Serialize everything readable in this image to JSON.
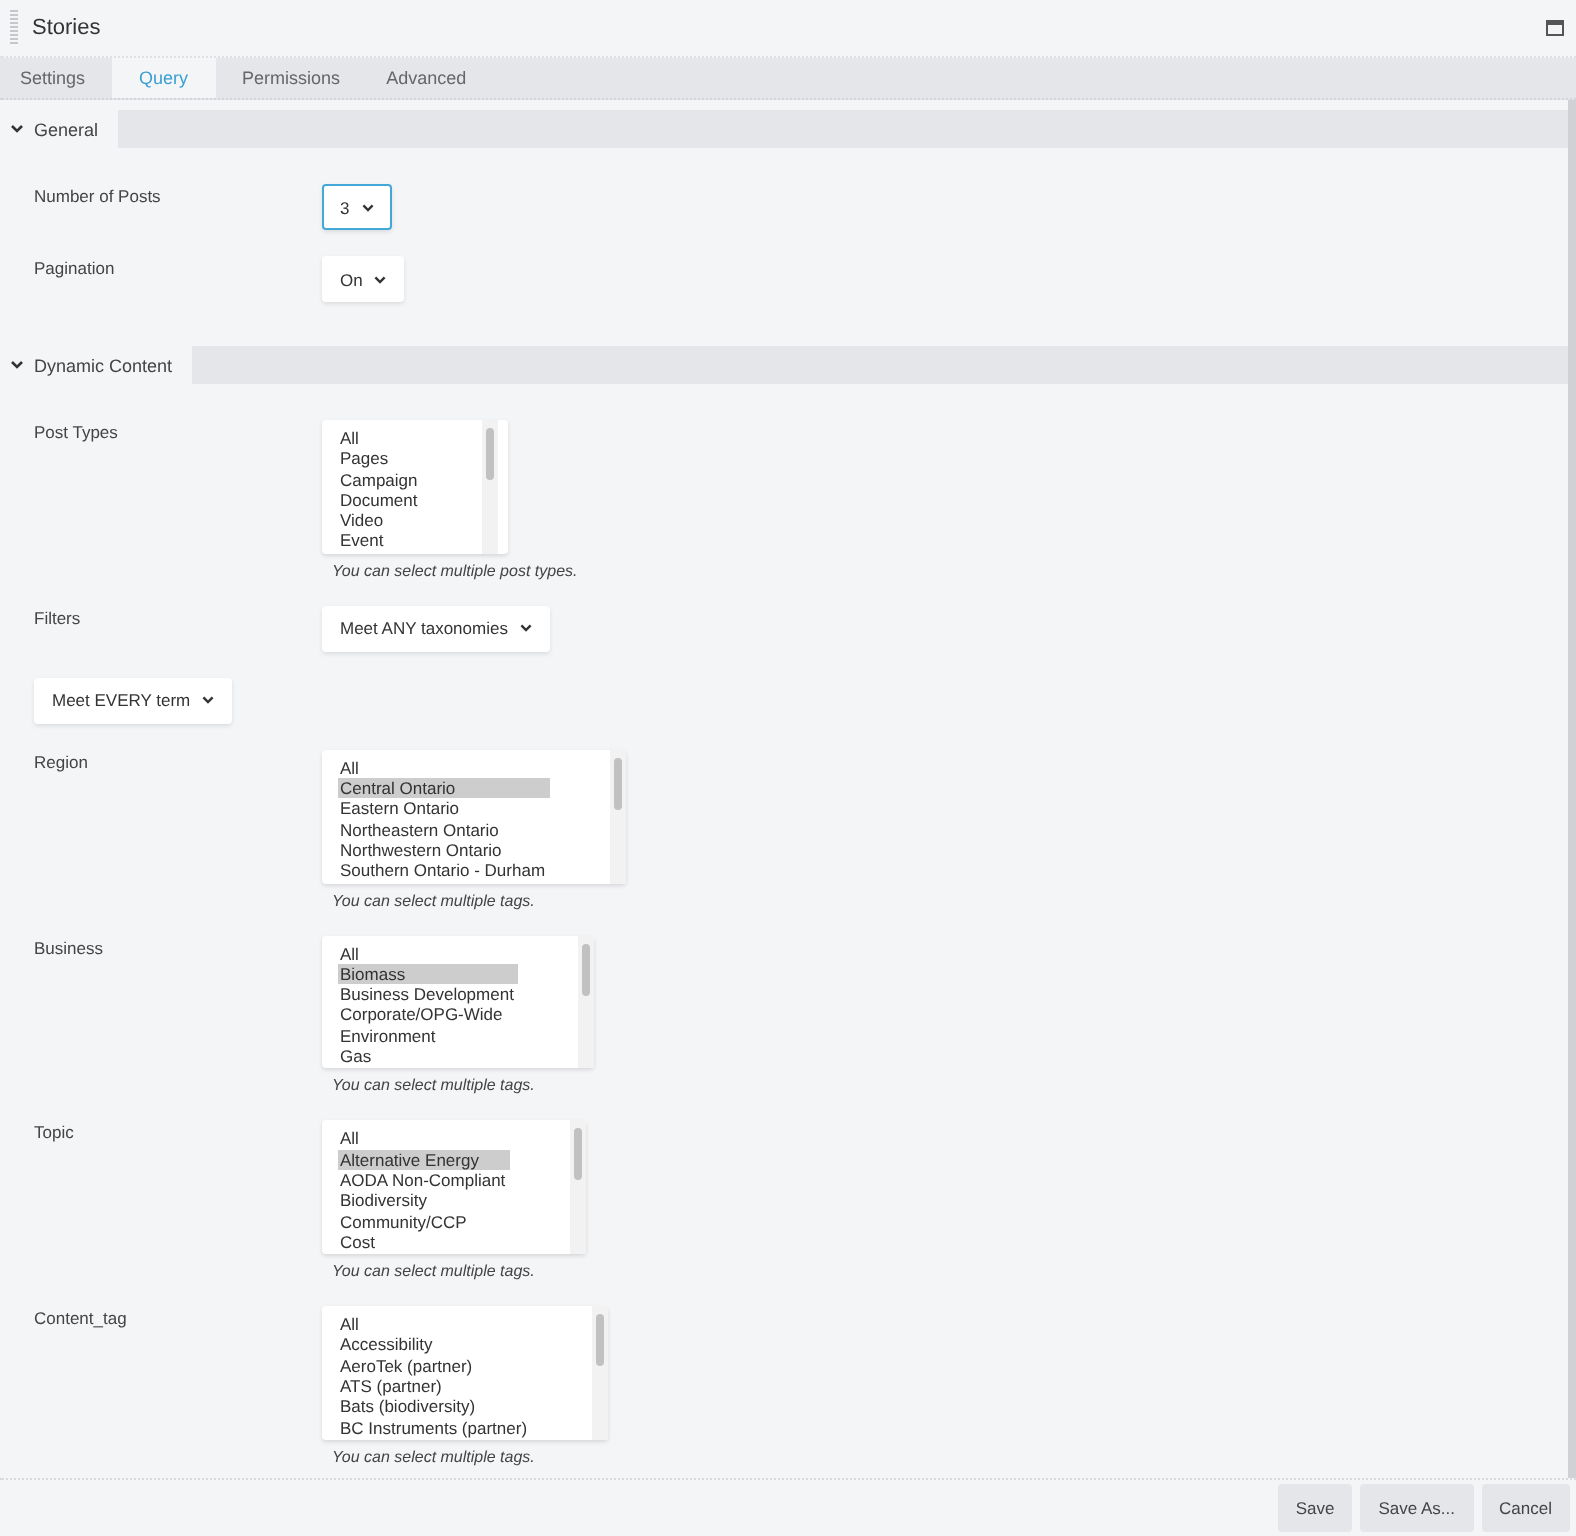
{
  "window": {
    "title": "Stories"
  },
  "tabs": [
    {
      "label": "Settings",
      "selected": false
    },
    {
      "label": "Query",
      "selected": true
    },
    {
      "label": "Permissions",
      "selected": false
    },
    {
      "label": "Advanced",
      "selected": false
    }
  ],
  "sections": [
    {
      "title": "General",
      "expanded": true,
      "fields": [
        {
          "kind": "select",
          "label": "Number of Posts",
          "value": "3",
          "focused": true
        },
        {
          "kind": "select",
          "label": "Pagination",
          "value": "On",
          "focused": false
        }
      ]
    },
    {
      "title": "Dynamic Content",
      "expanded": true,
      "fields": [
        {
          "kind": "listbox",
          "label": "Post Types",
          "help": "You can select multiple post types.",
          "options": [
            {
              "text": "All",
              "selected": false
            },
            {
              "text": "Pages",
              "selected": false
            },
            {
              "text": "Campaign",
              "selected": false
            },
            {
              "text": "Document",
              "selected": false
            },
            {
              "text": "Video",
              "selected": false
            },
            {
              "text": "Event",
              "selected": false
            }
          ]
        },
        {
          "kind": "select",
          "label": "Filters",
          "value": "Meet ANY taxonomies",
          "focused": false
        },
        {
          "kind": "select",
          "value": "Meet EVERY term",
          "focused": false
        },
        {
          "kind": "listbox",
          "label": "Region",
          "help": "You can select multiple tags.",
          "options": [
            {
              "text": "All",
              "selected": false
            },
            {
              "text": "Central Ontario",
              "selected": true
            },
            {
              "text": "Eastern Ontario",
              "selected": false
            },
            {
              "text": "Northeastern Ontario",
              "selected": false
            },
            {
              "text": "Northwestern Ontario",
              "selected": false
            },
            {
              "text": "Southern Ontario - Durham",
              "selected": false
            }
          ]
        },
        {
          "kind": "listbox",
          "label": "Business",
          "help": "You can select multiple tags.",
          "options": [
            {
              "text": "All",
              "selected": false
            },
            {
              "text": "Biomass",
              "selected": true
            },
            {
              "text": "Business Development",
              "selected": false
            },
            {
              "text": "Corporate/OPG-Wide",
              "selected": false
            },
            {
              "text": "Environment",
              "selected": false
            },
            {
              "text": "Gas",
              "selected": false
            }
          ]
        },
        {
          "kind": "listbox",
          "label": "Topic",
          "help": "You can select multiple tags.",
          "options": [
            {
              "text": "All",
              "selected": false
            },
            {
              "text": "Alternative Energy",
              "selected": true
            },
            {
              "text": "AODA Non-Compliant",
              "selected": false
            },
            {
              "text": "Biodiversity",
              "selected": false
            },
            {
              "text": "Community/CCP",
              "selected": false
            },
            {
              "text": "Cost",
              "selected": false
            }
          ]
        },
        {
          "kind": "listbox",
          "label": "Content_tag",
          "help": "You can select multiple tags.",
          "options": [
            {
              "text": "All",
              "selected": false
            },
            {
              "text": "Accessibility",
              "selected": false
            },
            {
              "text": "AeroTek (partner)",
              "selected": false
            },
            {
              "text": "ATS (partner)",
              "selected": false
            },
            {
              "text": "Bats (biodiversity)",
              "selected": false
            },
            {
              "text": "BC Instruments (partner)",
              "selected": false
            }
          ]
        }
      ]
    }
  ],
  "buttons": [
    "Save",
    "Save As...",
    "Cancel"
  ]
}
